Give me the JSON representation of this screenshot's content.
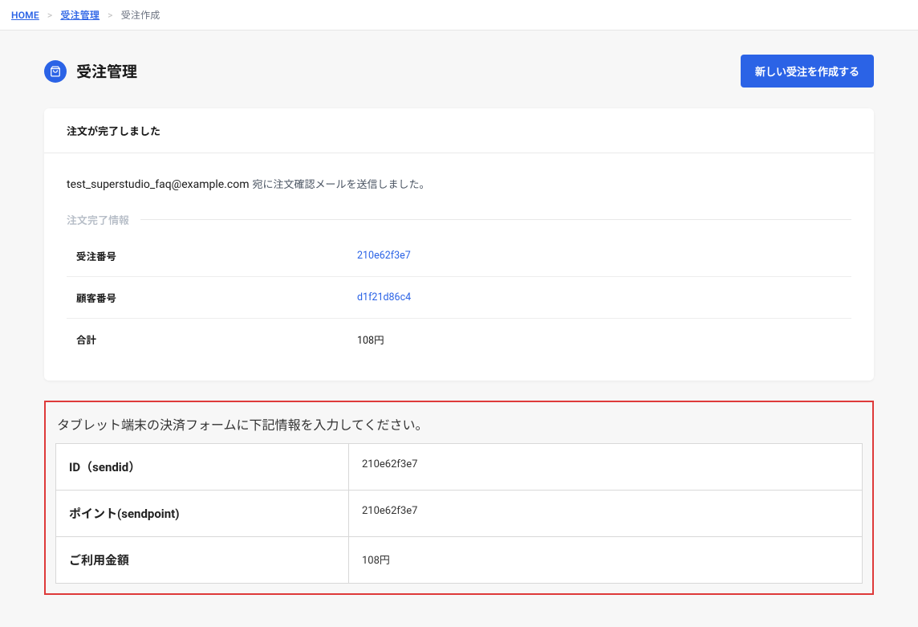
{
  "breadcrumb": {
    "home": "HOME",
    "mgmt": "受注管理",
    "current": "受注作成"
  },
  "header": {
    "title": "受注管理",
    "create_btn": "新しい受注を作成する"
  },
  "card": {
    "head": "注文が完了しました",
    "email_addr": "test_superstudio_faq@example.com",
    "email_tail": "宛に注文確認メールを送信しました。",
    "section_label": "注文完了情報",
    "rows": [
      {
        "k": "受注番号",
        "v": "210e62f3e7",
        "link": true
      },
      {
        "k": "顧客番号",
        "v": "d1f21d86c4",
        "link": true
      },
      {
        "k": "合計",
        "v": "108円",
        "link": false
      }
    ]
  },
  "tablet": {
    "instruction": "タブレット端末の決済フォームに下記情報を入力してください。",
    "rows": [
      {
        "k": "ID（sendid）",
        "v": "210e62f3e7"
      },
      {
        "k": "ポイント(sendpoint)",
        "v": "210e62f3e7"
      },
      {
        "k": "ご利用金額",
        "v": "108円"
      }
    ]
  }
}
